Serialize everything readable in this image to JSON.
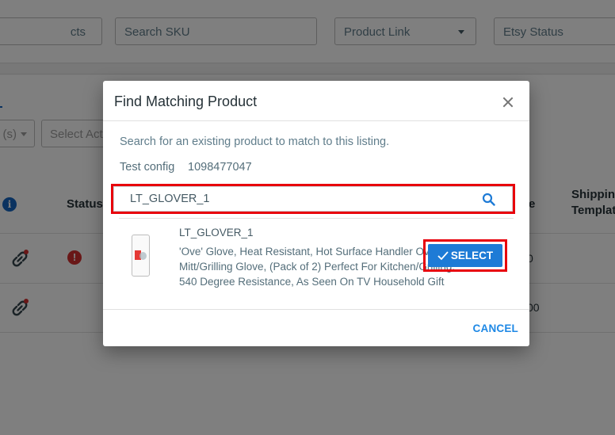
{
  "background": {
    "filters": {
      "products_placeholder": "cts",
      "sku_placeholder": "Search SKU",
      "product_link_label": "Product Link",
      "etsy_status_label": "Etsy Status"
    },
    "bulk": {
      "count_select": "(s)",
      "action_placeholder": "Select Act"
    },
    "table": {
      "headers": {
        "status": "Status",
        "price_partial": "e",
        "shipping_line1": "Shipping",
        "shipping_line2": "Template"
      },
      "rows": [
        {
          "link_icon": "unlinked-chain-icon",
          "status_icon": "error-icon",
          "status_glyph": "!",
          "price_partial": "0"
        },
        {
          "link_icon": "unlinked-chain-icon",
          "status_icon": "",
          "status_glyph": "",
          "price_partial": "00"
        }
      ]
    },
    "info_icon_glyph": "i"
  },
  "modal": {
    "title": "Find Matching Product",
    "description": "Search for an existing product to match to this listing.",
    "config_label": "Test config",
    "config_value": "1098477047",
    "search": {
      "value": "LT_GLOVER_1",
      "placeholder": ""
    },
    "result": {
      "sku": "LT_GLOVER_1",
      "description": "'Ove' Glove, Heat Resistant, Hot Surface Handler Oven Mitt/Grilling Glove, (Pack of 2) Perfect For Kitchen/Grilling, 540 Degree Resistance, As Seen On TV Household Gift",
      "select_label": "SELECT"
    },
    "cancel_label": "CANCEL"
  },
  "colors": {
    "primary": "#1e7bd6",
    "highlight_box": "#e8000b",
    "error": "#d32f2f",
    "info": "#1565c0"
  }
}
